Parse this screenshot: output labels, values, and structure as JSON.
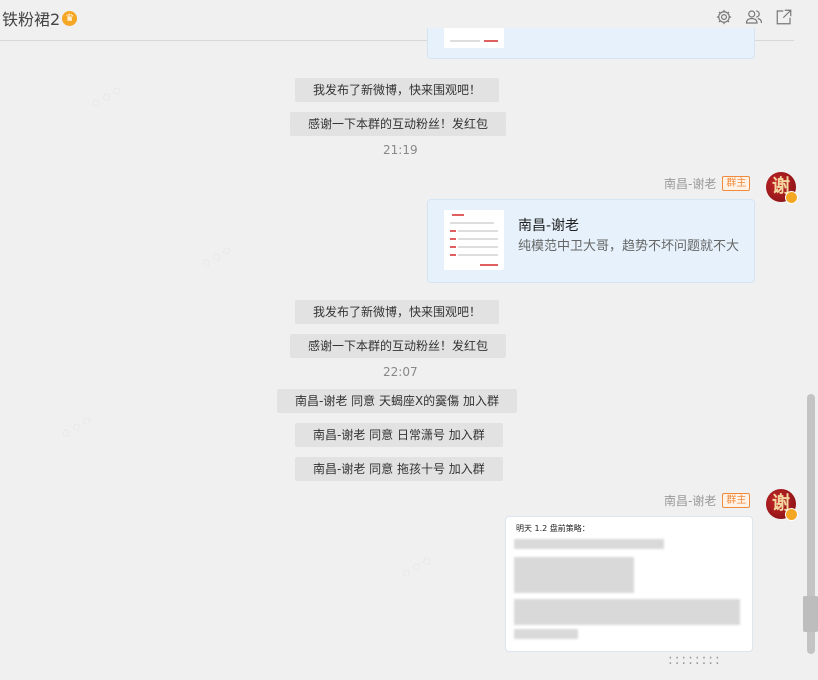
{
  "header": {
    "title": "铁粉裙2",
    "icons": [
      "gear-icon",
      "group-members-icon",
      "share-out-icon"
    ]
  },
  "messages": {
    "sys1": "我发布了新微博，快来围观吧！",
    "sys2": "感谢一下本群的互动粉丝！发红包",
    "time1": "21:19",
    "sender1": "南昌-谢老",
    "badge": "群主",
    "avatar_char": "谢",
    "card_title": "南昌-谢老",
    "card_desc": "纯模范中卫大哥，趋势不坏问题就不大",
    "sys3": "我发布了新微博，快来围观吧！",
    "sys4": "感谢一下本群的互动粉丝！发红包",
    "time2": "22:07",
    "join1": "南昌-谢老 同意 天蝎座X的霙傷 加入群",
    "join2": "南昌-谢老 同意 日常潇号 加入群",
    "join3": "南昌-谢老 同意 拖孩十号 加入群",
    "sender2": "南昌-谢老",
    "img_header": "明天 1.2 盘前策略："
  },
  "colors": {
    "accent": "#f08a3c",
    "card_bg": "#e6f1fb",
    "avatar": "#b01e22"
  }
}
